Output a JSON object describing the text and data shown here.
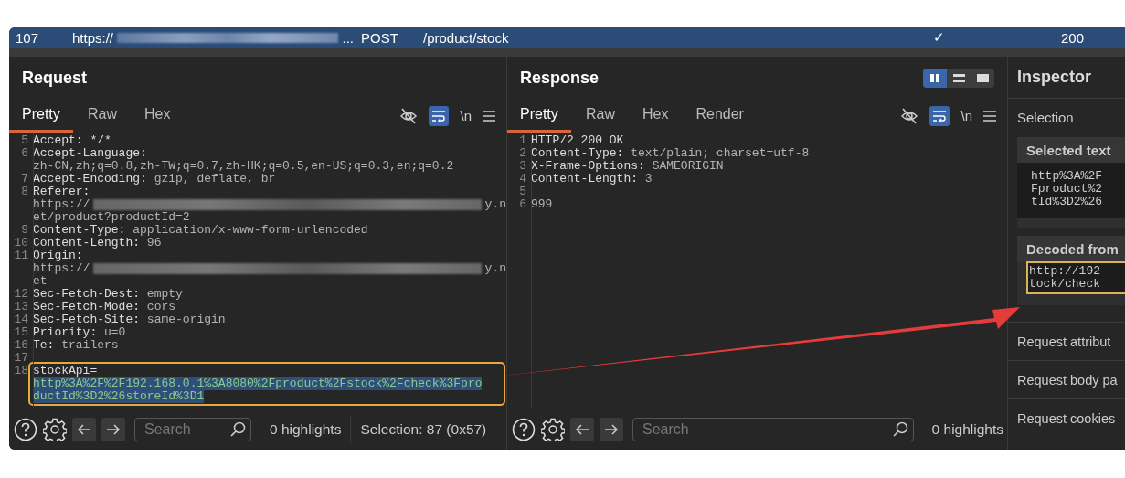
{
  "top_bar": {
    "number": "107",
    "url_start": "https://",
    "url_end": "...",
    "method": "POST",
    "path": "/product/stock",
    "check": "✓",
    "status": "200"
  },
  "request": {
    "title": "Request",
    "tabs": [
      {
        "label": "Pretty",
        "selected": true
      },
      {
        "label": "Raw",
        "selected": false
      },
      {
        "label": "Hex",
        "selected": false
      }
    ],
    "wrap_on": true,
    "newline_label": "\\n",
    "lines": [
      {
        "num": "5",
        "rows": [
          [
            {
              "kind": "key",
              "text": "Accept: */*"
            }
          ]
        ]
      },
      {
        "num": "6",
        "rows": [
          [
            {
              "kind": "key",
              "text": "Accept-Language:"
            }
          ],
          [
            {
              "kind": "value",
              "text": "zh-CN,zh;q=0.8,zh-TW;q=0.7,zh-HK;q=0.5,en-US;q=0.3,en;q=0.2"
            }
          ]
        ]
      },
      {
        "num": "7",
        "rows": [
          [
            {
              "kind": "key",
              "text": "Accept-Encoding:"
            },
            {
              "kind": "value",
              "text": " gzip, deflate, br"
            }
          ]
        ]
      },
      {
        "num": "8",
        "rows": [
          [
            {
              "kind": "key",
              "text": "Referer:"
            }
          ],
          [
            {
              "kind": "value",
              "text": "https://"
            },
            {
              "kind": "redacted"
            },
            {
              "kind": "value",
              "text": "y.n"
            }
          ],
          [
            {
              "kind": "value",
              "text": "et/product?productId=2"
            }
          ]
        ]
      },
      {
        "num": "9",
        "rows": [
          [
            {
              "kind": "key",
              "text": "Content-Type:"
            },
            {
              "kind": "value",
              "text": " application/x-www-form-urlencoded"
            }
          ]
        ]
      },
      {
        "num": "10",
        "rows": [
          [
            {
              "kind": "key",
              "text": "Content-Length:"
            },
            {
              "kind": "value",
              "text": " 96"
            }
          ]
        ]
      },
      {
        "num": "11",
        "rows": [
          [
            {
              "kind": "key",
              "text": "Origin:"
            }
          ],
          [
            {
              "kind": "value",
              "text": "https://"
            },
            {
              "kind": "redacted"
            },
            {
              "kind": "value",
              "text": "y.n"
            }
          ],
          [
            {
              "kind": "value",
              "text": "et"
            }
          ]
        ]
      },
      {
        "num": "12",
        "rows": [
          [
            {
              "kind": "key",
              "text": "Sec-Fetch-Dest:"
            },
            {
              "kind": "value",
              "text": " empty"
            }
          ]
        ]
      },
      {
        "num": "13",
        "rows": [
          [
            {
              "kind": "key",
              "text": "Sec-Fetch-Mode:"
            },
            {
              "kind": "value",
              "text": " cors"
            }
          ]
        ]
      },
      {
        "num": "14",
        "rows": [
          [
            {
              "kind": "key",
              "text": "Sec-Fetch-Site:"
            },
            {
              "kind": "value",
              "text": " same-origin"
            }
          ]
        ]
      },
      {
        "num": "15",
        "rows": [
          [
            {
              "kind": "key",
              "text": "Priority:"
            },
            {
              "kind": "value",
              "text": " u=0"
            }
          ]
        ]
      },
      {
        "num": "16",
        "rows": [
          [
            {
              "kind": "key",
              "text": "Te:"
            },
            {
              "kind": "value",
              "text": " trailers"
            }
          ]
        ]
      },
      {
        "num": "17"
      },
      {
        "num": "18",
        "highlighted": true,
        "rows": [
          [
            {
              "kind": "key",
              "text": "stockApi="
            }
          ],
          [
            {
              "kind": "selected",
              "text": "http%3A%2F%2F192.168.0.1%3A8080%2Fproduct%2Fstock%2Fcheck%3Fpro"
            }
          ],
          [
            {
              "kind": "selected",
              "text": "ductId%3D2%26storeId%3D1"
            }
          ]
        ]
      }
    ],
    "footer": {
      "search_placeholder": "Search",
      "highlights": "0 highlights",
      "selection": "Selection: 87 (0x57)"
    }
  },
  "response": {
    "title": "Response",
    "layout_modes": [
      {
        "kind": "columns",
        "selected": true
      },
      {
        "kind": "rows",
        "selected": false
      },
      {
        "kind": "single",
        "selected": false
      }
    ],
    "tabs": [
      {
        "label": "Pretty",
        "selected": true
      },
      {
        "label": "Raw",
        "selected": false
      },
      {
        "label": "Hex",
        "selected": false
      },
      {
        "label": "Render",
        "selected": false
      }
    ],
    "wrap_on": true,
    "newline_label": "\\n",
    "lines": [
      {
        "num": "1",
        "rows": [
          [
            {
              "kind": "key",
              "text": "HTTP/2 200 OK"
            }
          ]
        ]
      },
      {
        "num": "2",
        "rows": [
          [
            {
              "kind": "key",
              "text": "Content-Type:"
            },
            {
              "kind": "value",
              "text": " text/plain; charset=utf-8"
            }
          ]
        ]
      },
      {
        "num": "3",
        "rows": [
          [
            {
              "kind": "key",
              "text": "X-Frame-Options:"
            },
            {
              "kind": "value",
              "text": " SAMEORIGIN"
            }
          ]
        ]
      },
      {
        "num": "4",
        "rows": [
          [
            {
              "kind": "key",
              "text": "Content-Length:"
            },
            {
              "kind": "value",
              "text": " 3"
            }
          ]
        ]
      },
      {
        "num": "5"
      },
      {
        "num": "6",
        "rows": [
          [
            {
              "kind": "value",
              "text": "999"
            }
          ]
        ]
      }
    ],
    "footer": {
      "search_placeholder": "Search",
      "highlights": "0 highlights"
    }
  },
  "inspector": {
    "title": "Inspector",
    "selection_label": "Selection",
    "cards": [
      {
        "title": "Selected text",
        "lines": [
          "http%3A%2F",
          "Fproduct%2",
          "tId%3D2%26"
        ],
        "highlighted": false
      },
      {
        "title": "Decoded from",
        "lines": [
          "http://192",
          "tock/check"
        ],
        "highlighted": true
      }
    ],
    "sections": [
      "Request attribut",
      "Request body pa",
      "Request cookies"
    ]
  }
}
